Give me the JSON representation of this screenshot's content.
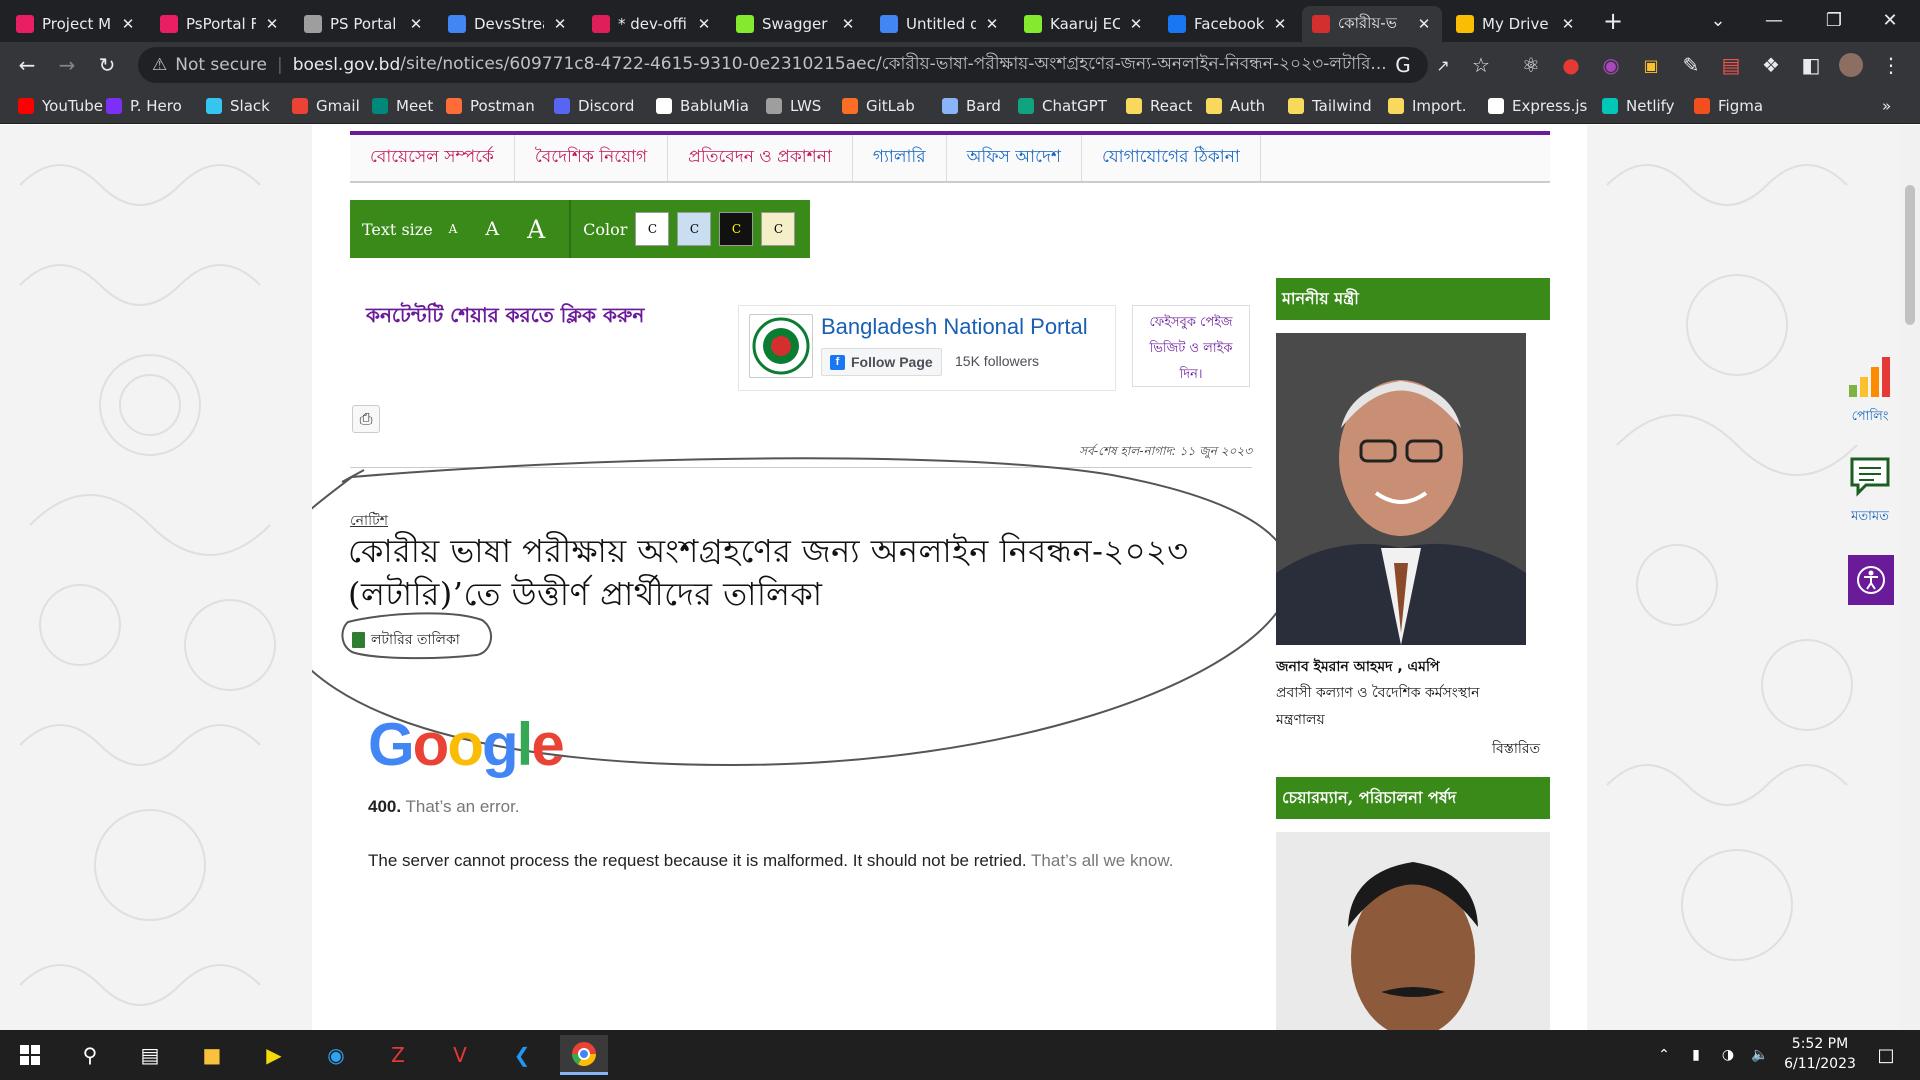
{
  "tabs": [
    {
      "title": "Project M",
      "color": "#e91e63",
      "active": false
    },
    {
      "title": "PsPortal F",
      "color": "#e91e63",
      "active": false
    },
    {
      "title": "PS Portal",
      "color": "#9e9e9e",
      "active": false
    },
    {
      "title": "DevsStrea",
      "color": "#4285f4",
      "active": false
    },
    {
      "title": "* dev-offi",
      "color": "#e01e5a",
      "active": false
    },
    {
      "title": "Swagger",
      "color": "#85ea2d",
      "active": false
    },
    {
      "title": "Untitled d",
      "color": "#4285f4",
      "active": false
    },
    {
      "title": "Kaaruj EC",
      "color": "#85ea2d",
      "active": false
    },
    {
      "title": "Facebook",
      "color": "#1877f2",
      "active": false
    },
    {
      "title": "কোরীয়-ভ",
      "color": "#d32f2f",
      "active": true
    },
    {
      "title": "My Drive",
      "color": "#fbbc04",
      "active": false
    }
  ],
  "toolbar": {
    "not_secure": "Not secure",
    "host": "boesl.gov.bd",
    "path": "/site/notices/609771c8-4722-4615-9310-0e2310215aec/কোরীয়-ভাষা-পরীক্ষায়-অংশগ্রহণের-জন্য-অনলাইন-নিবন্ধন-২০২৩-লটারি..."
  },
  "bookmarks": [
    {
      "label": "YouTube",
      "color": "#ff0000"
    },
    {
      "label": "P. Hero",
      "color": "#7b2ff7"
    },
    {
      "label": "Slack",
      "color": "#36c5f0"
    },
    {
      "label": "Gmail",
      "color": "#ea4335"
    },
    {
      "label": "Meet",
      "color": "#00897b"
    },
    {
      "label": "Postman",
      "color": "#ff6c37"
    },
    {
      "label": "Discord",
      "color": "#5865f2"
    },
    {
      "label": "BabluMia",
      "color": "#ffffff"
    },
    {
      "label": "LWS",
      "color": "#9e9e9e"
    },
    {
      "label": "GitLab",
      "color": "#fc6d26"
    },
    {
      "label": "Bard",
      "color": "#8ab4f8"
    },
    {
      "label": "ChatGPT",
      "color": "#10a37f"
    },
    {
      "label": "React",
      "color": "#f9d85e"
    },
    {
      "label": "Auth",
      "color": "#f9d85e"
    },
    {
      "label": "Tailwind",
      "color": "#f9d85e"
    },
    {
      "label": "Import.",
      "color": "#f9d85e"
    },
    {
      "label": "Express.js",
      "color": "#ffffff"
    },
    {
      "label": "Netlify",
      "color": "#00c7b7"
    },
    {
      "label": "Figma",
      "color": "#f24e1e"
    }
  ],
  "menu": [
    "বোয়েসেল সম্পর্কে",
    "বৈদেশিক নিয়োগ",
    "প্রতিবেদন ও প্রকাশনা",
    "গ্যালারি",
    "অফিস আদেশ",
    "যোগাযোগের ঠিকানা"
  ],
  "a11y": {
    "text_size_label": "Text size",
    "size_small": "A",
    "size_medium": "A",
    "size_large": "A",
    "color_label": "Color",
    "swatches": [
      {
        "label": "C",
        "bg": "#ffffff",
        "fg": "#000000"
      },
      {
        "label": "C",
        "bg": "#c9def0",
        "fg": "#000000"
      },
      {
        "label": "C",
        "bg": "#111111",
        "fg": "#ffff00"
      },
      {
        "label": "C",
        "bg": "#f5efc9",
        "fg": "#000000"
      }
    ]
  },
  "share_text": "কনটেন্টটি শেয়ার করতে ক্লিক করুন",
  "fb_widget": {
    "page_name": "Bangladesh National Portal",
    "follow_label": "Follow Page",
    "followers": "15K followers"
  },
  "fb_visit": "ফেইসবুক পেইজ ভিজিট ও লাইক দিন।",
  "last_update": "সর্ব-শেষ হাল-নাগাদ: ১১ জুন ২০২৩",
  "notice": {
    "label": "নোটিশ",
    "title": "কোরীয় ভাষা পরীক্ষায় অংশগ্রহণের জন্য অনলাইন নিবন্ধন-২০২৩ (লটারি)’তে উত্তীর্ণ প্রার্থীদের তালিকা",
    "attachment": "লটারির তালিকা"
  },
  "google_error": {
    "code": "400.",
    "short": "That’s an error.",
    "message": "The server cannot process the request because it is malformed. It should not be retried.",
    "tail": "That’s all we know."
  },
  "sidebar": {
    "minister_heading": "মাননীয় মন্ত্রী",
    "minister_name": "জনাব ইমরান আহমদ , এমপি",
    "minister_role": "প্রবাসী কল্যাণ ও বৈদেশিক কর্মসংস্থান মন্ত্রণালয়",
    "more": "বিস্তারিত",
    "chair_heading": "চেয়ারম্যান, পরিচালনা পর্ষদ"
  },
  "floating": {
    "polling": "পোলিং",
    "feedback": "মতামত"
  },
  "taskbar": {
    "time": "5:52 PM",
    "date": "6/11/2023"
  }
}
